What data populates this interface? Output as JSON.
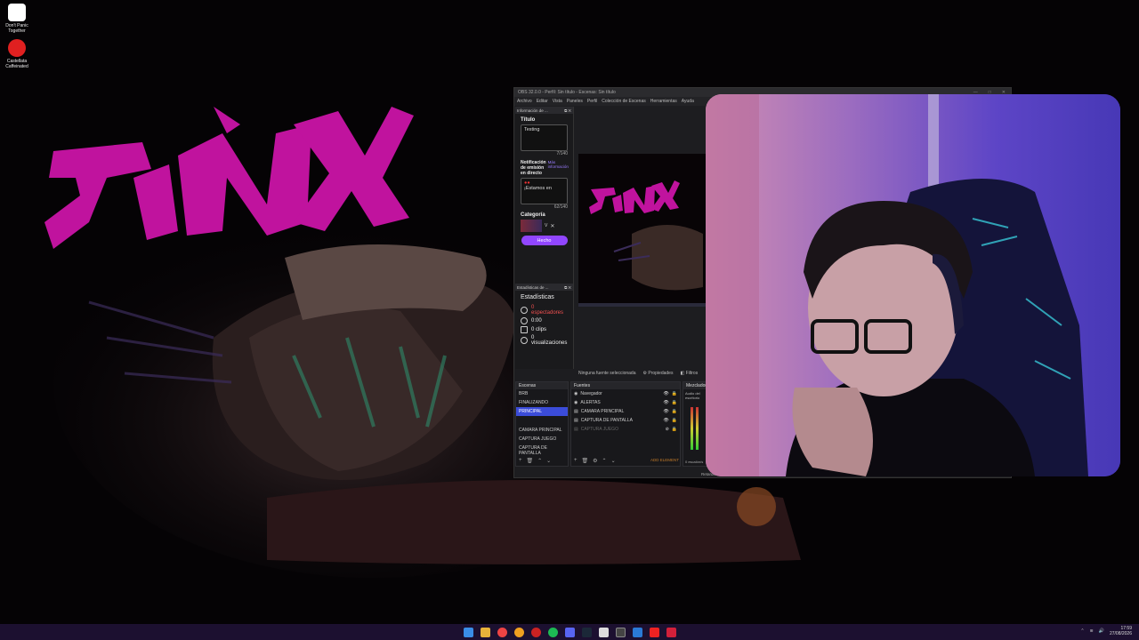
{
  "desktop": {
    "icons": [
      {
        "label": "Don't Panic Together",
        "name": "dont-panic-together-icon"
      },
      {
        "label": "Castellata Caffeinated",
        "name": "castellata-caffeinated-icon"
      }
    ],
    "wallpaper_text": "JINX"
  },
  "obs": {
    "title": "OBS 32.0.0 - Perfil: Sin título - Escenas: Sin título",
    "menu": [
      "Archivo",
      "Editar",
      "Vista",
      "Paneles",
      "Perfil",
      "Colección de Escenas",
      "Herramientas",
      "Ayuda"
    ],
    "info_dock": {
      "header": "Información de ...",
      "title_label": "Título",
      "title_value": "Testing",
      "title_counter": "7/140",
      "notif_label": "Notificación de emisión en directo",
      "notif_side": "Más información",
      "notif_value": "¡Estamos en",
      "notif_counter": "62/140",
      "category_label": "Categoría",
      "category_value": "V",
      "done_label": "Hecho"
    },
    "stats_dock": {
      "header": "Estadísticas de ...",
      "title": "Estadísticas",
      "viewers": "0 espectadores",
      "time": "0:00",
      "clips": "0 clips",
      "views": "0 visualizaciones"
    },
    "source_bar": {
      "no_source": "Ninguna fuente seleccionada",
      "properties": "Propiedades",
      "filters": "Filtros"
    },
    "scenes": {
      "header": "Escenas",
      "items": [
        "BRB",
        "FINALIZANDO",
        "PRINCIPAL",
        "",
        "CAMARA PRINCIPAL",
        "CAPTURA JUEGO",
        "CAPTURA DE PANTALLA"
      ],
      "active_index": 2
    },
    "sources": {
      "header": "Fuentes",
      "items": [
        "Navegador",
        "ALERTAS",
        "CAMARA PRINCIPAL",
        "CAPTURA DE PANTALLA",
        "CAPTURA JUEGO"
      ],
      "add_label": "ADD ELEMENT"
    },
    "mixer": {
      "header": "Mezclador",
      "channel": "Audio del escritorio",
      "value": "0 escalón/s"
    },
    "status": "Retardo 0 seg"
  },
  "taskbar": {
    "time": "17:59",
    "date": "27/08/2026",
    "icon_names": [
      "windows-start-icon",
      "file-explorer-icon",
      "chrome-icon",
      "browser-icon",
      "opera-gx-icon",
      "spotify-icon",
      "discord-icon",
      "steam-icon",
      "epic-games-icon",
      "obs-icon",
      "vscode-icon",
      "youtube-icon",
      "app-red-icon"
    ]
  }
}
